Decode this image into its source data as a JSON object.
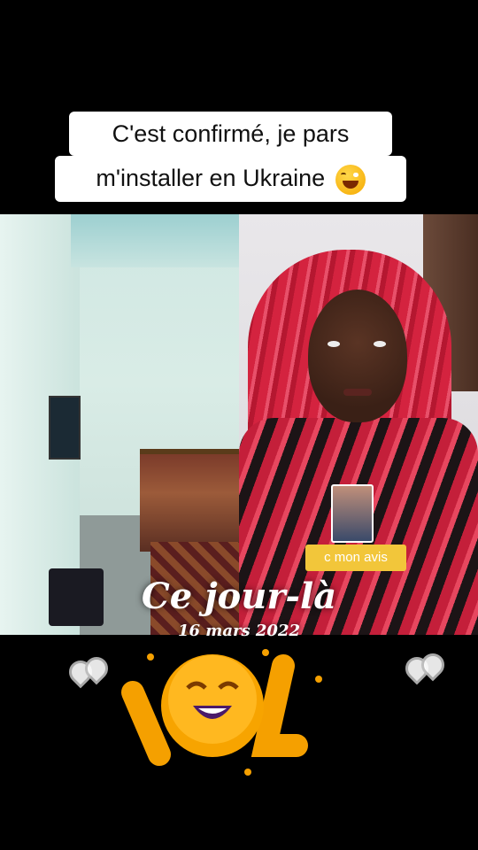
{
  "caption": {
    "line1": "C'est confirmé, je pars",
    "line2": "m'installer en Ukraine",
    "emoji": "rolling-on-floor-laughing"
  },
  "video": {
    "left_scene": "room with bed and tv",
    "right_scene": "woman in red striped hijab"
  },
  "sticker": {
    "label": "c mon avis",
    "color": "#f2c63a"
  },
  "memory": {
    "title": "Ce jour-là",
    "date": "16 mars 2022"
  },
  "lol_sticker": {
    "text": "LOL",
    "color": "#f5a000"
  },
  "colors": {
    "background": "#000000",
    "caption_bg": "#ffffff",
    "accent": "#f5a000"
  }
}
